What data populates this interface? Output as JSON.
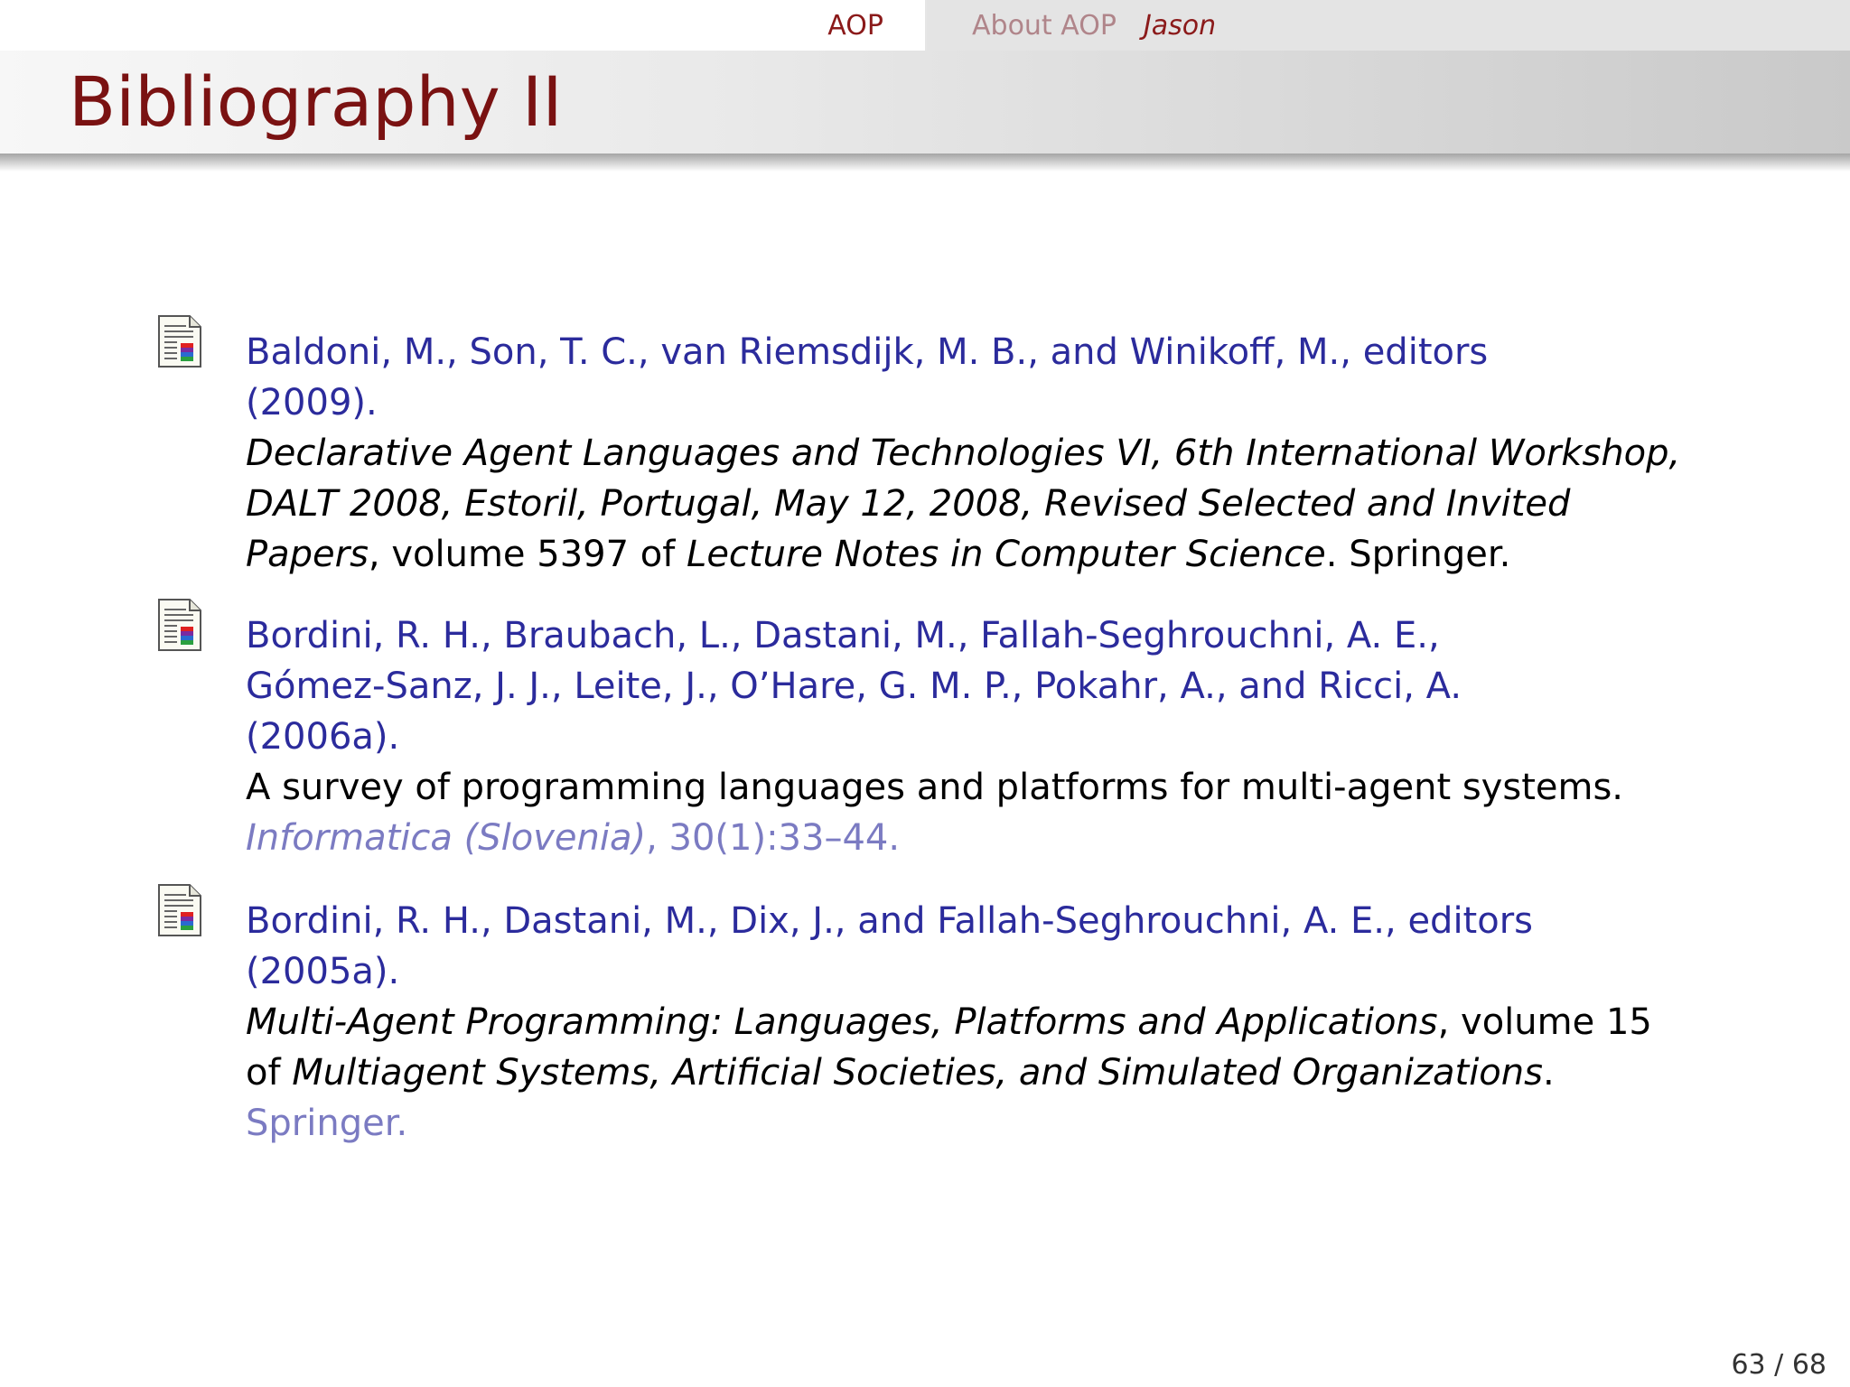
{
  "nav": {
    "section": "AOP",
    "subsection": "About AOP",
    "current": "Jason"
  },
  "frame_title": "Bibliography II",
  "entries": [
    {
      "author_lines": [
        "Baldoni, M., Son, T. C., van Riemsdijk, M. B., and Winikoff, M., editors",
        "(2009)."
      ],
      "title_line1": "Declarative Agent Languages and Technologies VI, 6th International Workshop,",
      "title_line2": "DALT 2008, Estoril, Portugal, May 12, 2008, Revised Selected and Invited",
      "title_line3_italic": "Papers",
      "title_line3_plain1": ", volume 5397 of ",
      "title_line3_series": "Lecture Notes in Computer Science",
      "title_line3_plain2": ". Springer."
    },
    {
      "author_lines": [
        "Bordini, R. H., Braubach, L., Dastani, M., Fallah-Seghrouchni, A. E.,",
        "Gómez-Sanz, J. J., Leite, J., O’Hare, G. M. P., Pokahr, A., and Ricci, A.",
        "(2006a)."
      ],
      "title": "A survey of programming languages and platforms for multi-agent systems.",
      "journal": "Informatica (Slovenia)",
      "journal_rest": ", 30(1):33–44."
    },
    {
      "author_lines": [
        "Bordini, R. H., Dastani, M., Dix, J., and Fallah-Seghrouchni, A. E., editors",
        "(2005a)."
      ],
      "title_line1_italic": "Multi-Agent Programming: Languages, Platforms and Applications",
      "title_line1_plain": ", volume 15",
      "title_line2_plain": "of ",
      "title_line2_italic": "Multiagent Systems, Artificial Societies, and Simulated Organizations",
      "title_line2_end": ".",
      "publisher": "Springer."
    }
  ],
  "page_number": "63 / 68",
  "colors": {
    "title": "#7a1212",
    "nav_section": "#8b1a1a",
    "authors": "#2b2b9c",
    "muted": "#7b7bc2"
  },
  "icons": [
    "article-icon"
  ]
}
